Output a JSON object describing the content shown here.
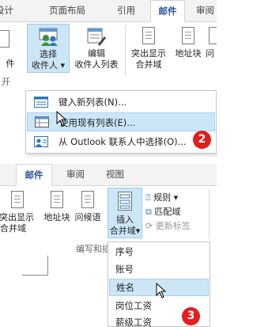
{
  "panel1": {
    "tabs": [
      "设计",
      "页面布局",
      "引用",
      "邮件",
      "审阅"
    ],
    "active_tab": "邮件",
    "ribbon": {
      "partial_left": "件",
      "select_recipients": [
        "选择",
        "收件人"
      ],
      "edit_recipient_list": [
        "编辑",
        "收件人列表"
      ],
      "highlight_merge_fields": [
        "突出显示",
        "合并域"
      ],
      "address_block": "地址块",
      "greeting_line_partial": "问",
      "group_label_partial": "开"
    },
    "menu": {
      "items": [
        {
          "label": "键入新列表(N)..."
        },
        {
          "label": "使用现有列表(E)..."
        },
        {
          "label": "从 Outlook 联系人中选择(O)..."
        }
      ],
      "highlighted_index": 1
    },
    "step_badge": "2"
  },
  "panel2": {
    "tabs": [
      "邮件",
      "审阅",
      "视图"
    ],
    "active_tab": "邮件",
    "ribbon": {
      "highlight_merge_fields": [
        "突出显示",
        "合并域"
      ],
      "address_block": "地址块",
      "greeting_line": "问候语",
      "insert_merge_field": [
        "插入",
        "合并域"
      ],
      "rules": "规则",
      "match_fields": "匹配域",
      "update_labels": "更新标签",
      "group_label": "编写和插"
    },
    "field_list": [
      "序号",
      "账号",
      "姓名",
      "岗位工资",
      "薪级工资"
    ],
    "highlighted_field_index": 2,
    "step_badge": "3"
  },
  "colors": {
    "accent": "#2b579a",
    "highlight": "#cde6f7",
    "badge": "#e21e1e"
  },
  "icons": [
    "people-icon",
    "edit-list-icon",
    "document-icon",
    "table-icon",
    "outlook-icon",
    "arrow-cursor-icon"
  ]
}
